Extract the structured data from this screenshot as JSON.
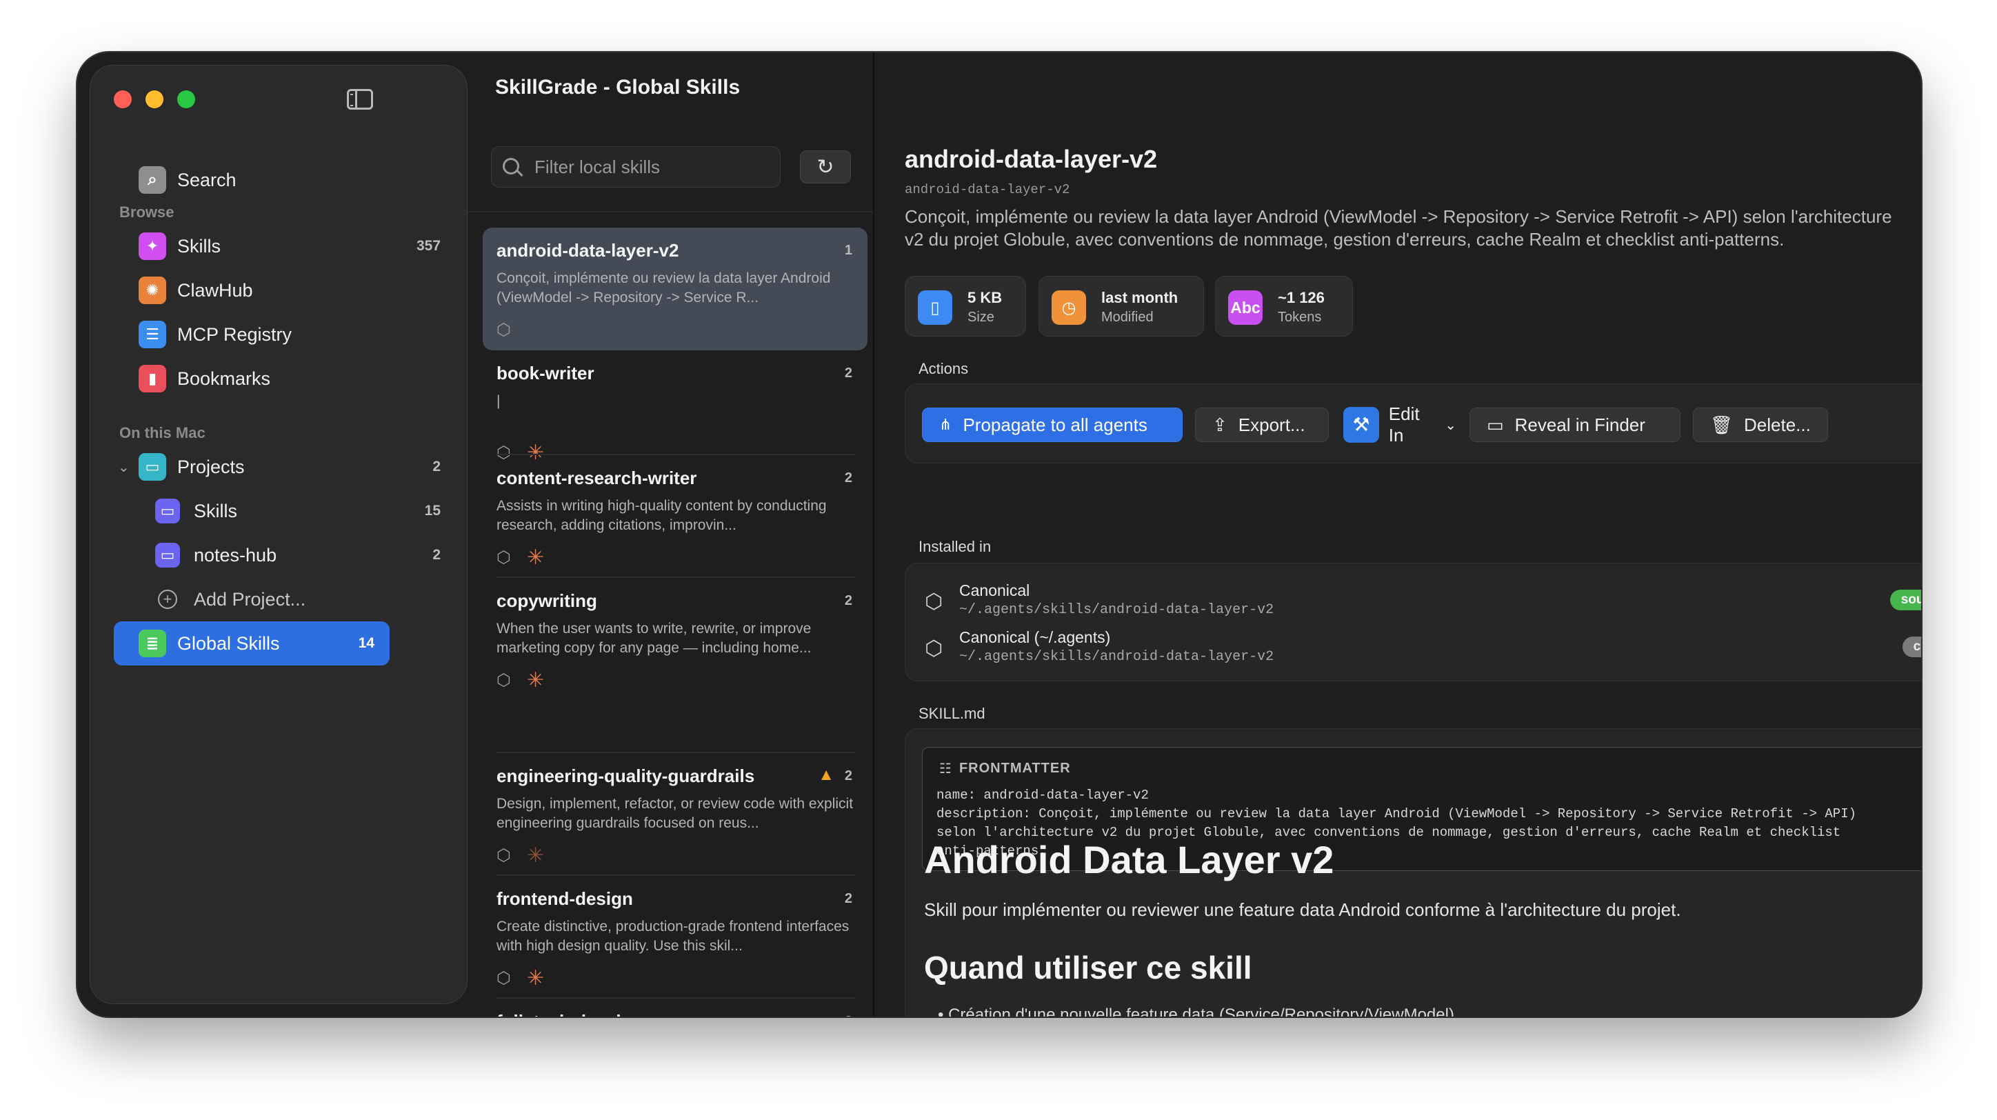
{
  "app": {
    "title": "SkillGrade - Global Skills"
  },
  "sidebar": {
    "search_label": "Search",
    "browse_section": "Browse",
    "browse": [
      {
        "label": "Skills",
        "count": "357"
      },
      {
        "label": "ClawHub",
        "count": ""
      },
      {
        "label": "MCP Registry",
        "count": ""
      },
      {
        "label": "Bookmarks",
        "count": ""
      }
    ],
    "mac_section": "On this Mac",
    "projects": {
      "label": "Projects",
      "count": "2"
    },
    "project_items": [
      {
        "label": "Skills",
        "count": "15"
      },
      {
        "label": "notes-hub",
        "count": "2"
      }
    ],
    "add_project": "Add Project...",
    "global_skills": {
      "label": "Global Skills",
      "count": "14"
    }
  },
  "list": {
    "filter_placeholder": "Filter local skills",
    "items": [
      {
        "name": "android-data-layer-v2",
        "count": "1",
        "desc": "Conçoit, implémente ou review la data layer Android (ViewModel -> Repository -> Service R..."
      },
      {
        "name": "book-writer",
        "count": "2",
        "desc": "|"
      },
      {
        "name": "content-research-writer",
        "count": "2",
        "desc": "Assists in writing high-quality content by conducting research, adding citations, improvin..."
      },
      {
        "name": "copywriting",
        "count": "2",
        "desc": "When the user wants to write, rewrite, or improve marketing copy for any page — including home..."
      },
      {
        "name": "engineering-quality-guardrails",
        "count": "2",
        "desc": "Design, implement, refactor, or review code with explicit engineering guardrails focused on reus..."
      },
      {
        "name": "frontend-design",
        "count": "2",
        "desc": "Create distinctive, production-grade frontend interfaces with high design quality. Use this skil..."
      },
      {
        "name": "fullstack-developer",
        "count": "2",
        "desc": "|"
      }
    ]
  },
  "detail": {
    "title": "android-data-layer-v2",
    "subtitle": "android-data-layer-v2",
    "description": "Conçoit, implémente ou review la data layer Android (ViewModel -> Repository -> Service Retrofit -> API) selon l'architecture v2 du projet Globule, avec conventions de nommage, gestion d'erreurs, cache Realm et checklist anti-patterns.",
    "stats": [
      {
        "value": "5 KB",
        "label": "Size",
        "icon": "document-icon"
      },
      {
        "value": "last month",
        "label": "Modified",
        "icon": "clock-icon"
      },
      {
        "value": "~1 126",
        "label": "Tokens",
        "icon": "Abc"
      }
    ],
    "actions_label": "Actions",
    "actions": {
      "propagate": "Propagate to all agents",
      "export": "Export...",
      "edit_in": "Edit In",
      "reveal": "Reveal in Finder",
      "delete": "Delete..."
    },
    "installed_label": "Installed in",
    "installed": [
      {
        "name": "Canonical",
        "path": "~/.agents/skills/android-data-layer-v2",
        "badge": "source"
      },
      {
        "name": "Canonical (~/.agents)",
        "path": "~/.agents/skills/android-data-layer-v2",
        "badge": "copy"
      }
    ],
    "skillmd_label": "SKILL.md",
    "frontmatter_label": "FRONTMATTER",
    "frontmatter": "name: android-data-layer-v2\ndescription: Conçoit, implémente ou review la data layer Android (ViewModel -> Repository -> Service Retrofit -> API)\nselon l'architecture v2 du projet Globule, avec conventions de nommage, gestion d'erreurs, cache Realm et checklist\nanti-patterns.",
    "md_h1": "Android Data Layer v2",
    "md_p": "Skill pour implémenter ou reviewer une feature data Android conforme à l'architecture du projet.",
    "md_h2": "Quand utiliser ce skill",
    "md_li": "Création d'une nouvelle feature data (Service/Repository/ViewModel)"
  },
  "colors": {
    "accent": "#2d6fe0",
    "source_badge": "#46b54c",
    "copy_badge": "#7b7b7b",
    "warning": "#f5a524",
    "claude_star": "#e07b4f"
  }
}
